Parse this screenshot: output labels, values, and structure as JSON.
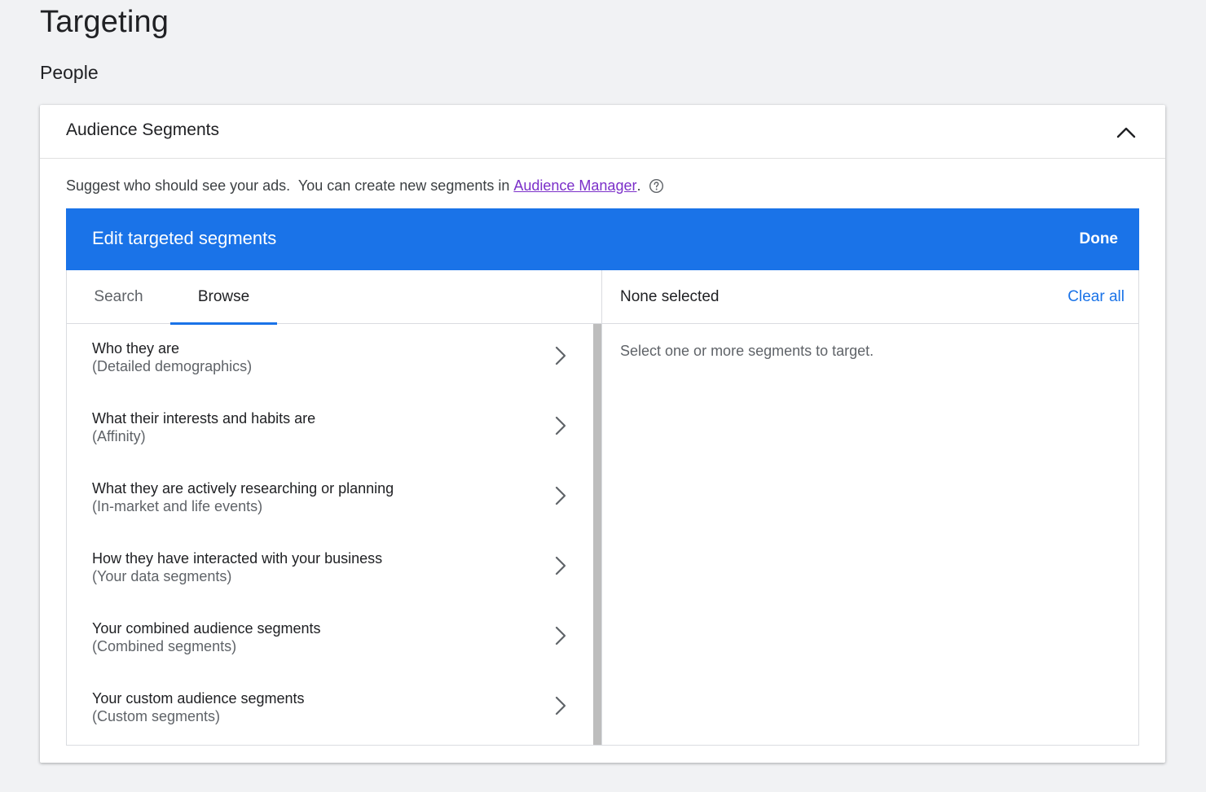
{
  "page": {
    "title": "Targeting",
    "section": "People"
  },
  "card": {
    "title": "Audience Segments",
    "collapse_icon": "chevron-up-icon",
    "helper_text": "Suggest who should see your ads.  You can create new segments in ",
    "helper_link": "Audience Manager",
    "helper_suffix": ".",
    "help_icon": "help-circle-icon"
  },
  "editor": {
    "title": "Edit targeted segments",
    "done_label": "Done",
    "accent_color": "#1a73e8",
    "tabs": [
      {
        "label": "Search",
        "active": false
      },
      {
        "label": "Browse",
        "active": true
      }
    ],
    "items": [
      {
        "label": "Who they are",
        "sub": "(Detailed demographics)"
      },
      {
        "label": "What their interests and habits are",
        "sub": "(Affinity)"
      },
      {
        "label": "What they are actively researching or planning",
        "sub": "(In-market and life events)"
      },
      {
        "label": "How they have interacted with your business",
        "sub": "(Your data segments)"
      },
      {
        "label": "Your combined audience segments",
        "sub": "(Combined segments)"
      },
      {
        "label": "Your custom audience segments",
        "sub": "(Custom segments)"
      }
    ],
    "item_icon": "chevron-right-icon",
    "selection": {
      "status": "None selected",
      "clear_label": "Clear all",
      "empty_message": "Select one or more segments to target."
    }
  }
}
